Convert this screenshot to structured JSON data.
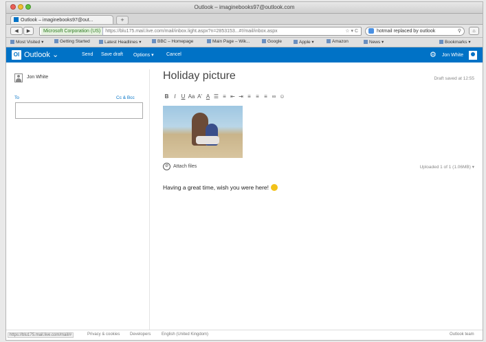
{
  "window": {
    "title": "Outlook – imaginebooks97@outlook.com"
  },
  "tab": {
    "label": "Outlook – imaginebooks97@out...",
    "new_tab": "+"
  },
  "nav": {
    "back": "◀",
    "forward": "▶",
    "identity": "Microsoft Corporation (US)",
    "url": "https://blu175.mail.live.com/mail/inbox.light.aspx?n=2853153...#!/mail/inbox.aspx",
    "search_value": "hotmail replaced by outlook",
    "home": "⌂"
  },
  "bookmarks": {
    "items": [
      "Most Visited ▾",
      "Getting Started",
      "Latest Headlines ▾",
      "BBC – Homepage",
      "Main Page – Wik...",
      "Google",
      "Apple ▾",
      "Amazon",
      "News ▾"
    ],
    "right": "Bookmarks ▾"
  },
  "outlook": {
    "logo": "Ol",
    "app_name": "Outlook",
    "send": "Send",
    "save_draft": "Save draft",
    "options": "Options ▾",
    "cancel": "Cancel",
    "user": "Jon White"
  },
  "compose": {
    "from_name": "Jon White",
    "to_label": "To",
    "cc_bcc": "Cc & Bcc",
    "subject": "Holiday picture",
    "draft_status": "Draft saved at 12:55",
    "attach_label": "Attach files",
    "uploaded": "Uploaded 1 of 1 (1.06MB) ▾",
    "body": "Having a great time, wish you were here!"
  },
  "format_toolbar": {
    "items": [
      {
        "name": "bold-button",
        "glyph": "B"
      },
      {
        "name": "italic-button",
        "glyph": "I"
      },
      {
        "name": "underline-button",
        "glyph": "U"
      },
      {
        "name": "font-size-button",
        "glyph": "Aa"
      },
      {
        "name": "grow-font-button",
        "glyph": "A'"
      },
      {
        "name": "font-color-button",
        "glyph": "A"
      },
      {
        "name": "bullets-button",
        "glyph": "☰"
      },
      {
        "name": "numbering-button",
        "glyph": "≡"
      },
      {
        "name": "outdent-button",
        "glyph": "⇤"
      },
      {
        "name": "indent-button",
        "glyph": "⇥"
      },
      {
        "name": "align-left-button",
        "glyph": "≡"
      },
      {
        "name": "align-center-button",
        "glyph": "≡"
      },
      {
        "name": "align-right-button",
        "glyph": "≡"
      },
      {
        "name": "link-button",
        "glyph": "∞"
      },
      {
        "name": "emoticon-button",
        "glyph": "☺"
      }
    ]
  },
  "status": {
    "url": "https://blu175.mail.live.com/mail/#",
    "privacy": "Privacy & cookies",
    "developers": "Developers",
    "language": "English (United Kingdom)",
    "team": "Outlook team"
  },
  "colors": {
    "outlook_blue": "#0072c6",
    "link_blue": "#0072c6"
  }
}
